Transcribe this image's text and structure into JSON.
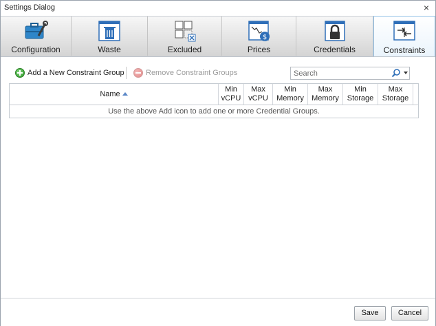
{
  "window": {
    "title": "Settings Dialog",
    "close_glyph": "×"
  },
  "tabs": [
    {
      "label": "Configuration",
      "icon": "toolbox-wrench-icon",
      "active": false
    },
    {
      "label": "Waste",
      "icon": "trash-window-icon",
      "active": false
    },
    {
      "label": "Excluded",
      "icon": "excluded-grid-icon",
      "active": false
    },
    {
      "label": "Prices",
      "icon": "price-chart-dollar-icon",
      "active": false
    },
    {
      "label": "Credentials",
      "icon": "lock-window-icon",
      "active": false
    },
    {
      "label": "Constraints",
      "icon": "constraint-arrows-icon",
      "active": true
    }
  ],
  "toolbar": {
    "add_label": "Add a New Constraint Group",
    "remove_label": "Remove Constraint Groups",
    "search_placeholder": "Search"
  },
  "grid": {
    "columns": [
      "Name",
      "Min\nvCPU",
      "Max\nvCPU",
      "Min\nMemory",
      "Max\nMemory",
      "Min\nStorage",
      "Max\nStorage"
    ],
    "sort_column": "Name",
    "empty_message": "Use the above Add icon to add one or more Credential Groups."
  },
  "footer": {
    "save_label": "Save",
    "cancel_label": "Cancel"
  },
  "colors": {
    "accent": "#2f6fb8",
    "active_tab_border": "#92c0e6",
    "add_green": "#2f9a2a"
  }
}
